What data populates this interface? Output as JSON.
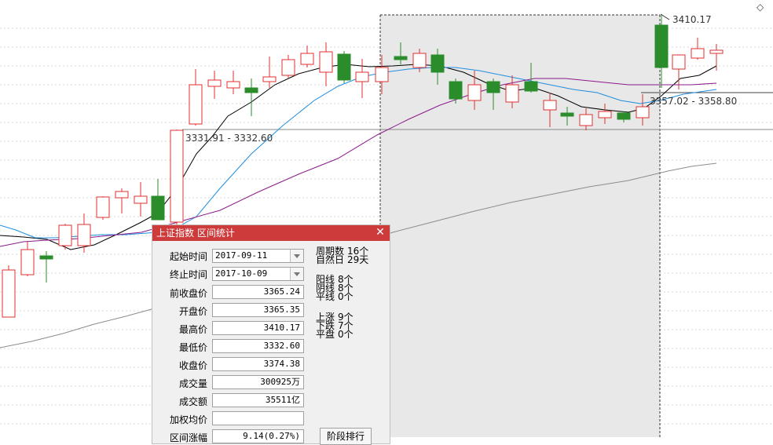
{
  "chart": {
    "high_marker": "3410.17",
    "range_label_left": "3331.91 - 3332.60",
    "range_label_right": "3357.02 - 3358.80",
    "up_color": "#e03030",
    "down_color": "#2a8c2a",
    "ma_colors": [
      "#000000",
      "#1e8ee0",
      "#8a1a8a",
      "#8c8c8c"
    ],
    "selection_color": "#e8e8e8",
    "corner_icon": "diamond-icon"
  },
  "dialog": {
    "title": "上证指数 区间统计",
    "close": "✕",
    "start_label": "起始时间",
    "start_value": "2017-09-11",
    "end_label": "终止时间",
    "end_value": "2017-10-09",
    "rows": [
      {
        "label": "前收盘价",
        "value": "3365.24"
      },
      {
        "label": "开盘价",
        "value": "3365.35"
      },
      {
        "label": "最高价",
        "value": "3410.17"
      },
      {
        "label": "最低价",
        "value": "3332.60"
      },
      {
        "label": "收盘价",
        "value": "3374.38"
      },
      {
        "label": "成交量",
        "value": "300925万"
      },
      {
        "label": "成交额",
        "value": "35511亿"
      },
      {
        "label": "加权均价",
        "value": ""
      },
      {
        "label": "区间涨幅",
        "value": "9.14(0.27%)"
      }
    ],
    "stats": {
      "periods_label": "周期数",
      "periods_value": "16个",
      "days_label": "自然日",
      "days_value": "29天",
      "yang_label": "阳线",
      "yang_value": "8个",
      "yin_label": "阴线",
      "yin_value": "8个",
      "flat_label": "平线",
      "flat_value": "0个",
      "up_label": "上涨",
      "up_value": "9个",
      "down_label": "下跌",
      "down_value": "7个",
      "even_label": "平盘",
      "even_value": "0个"
    },
    "stage_button": "阶段排行"
  }
}
